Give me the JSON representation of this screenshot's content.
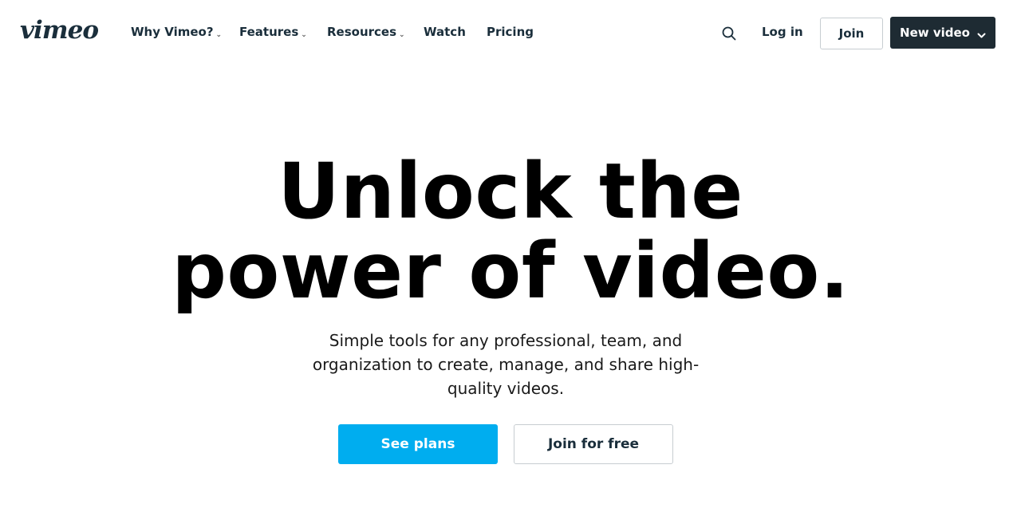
{
  "header": {
    "logo_text": "vimeo",
    "nav": [
      {
        "label": "Why Vimeo?",
        "has_dropdown": true
      },
      {
        "label": "Features",
        "has_dropdown": true
      },
      {
        "label": "Resources",
        "has_dropdown": true
      },
      {
        "label": "Watch",
        "has_dropdown": false
      },
      {
        "label": "Pricing",
        "has_dropdown": false
      }
    ],
    "search_icon": "search-icon",
    "login_label": "Log in",
    "join_label": "Join",
    "new_video_label": "New video"
  },
  "hero": {
    "title_line1": "Unlock the",
    "title_line2": "power of video.",
    "subtitle": "Simple tools for any professional, team, and organization to create, manage, and share high-quality videos.",
    "primary_cta": "See plans",
    "secondary_cta": "Join for free"
  },
  "colors": {
    "brand_dark": "#1a2e3b",
    "new_video_bg": "#1e2b33",
    "primary_cta_bg": "#00adef",
    "border": "#c7cdd1"
  }
}
